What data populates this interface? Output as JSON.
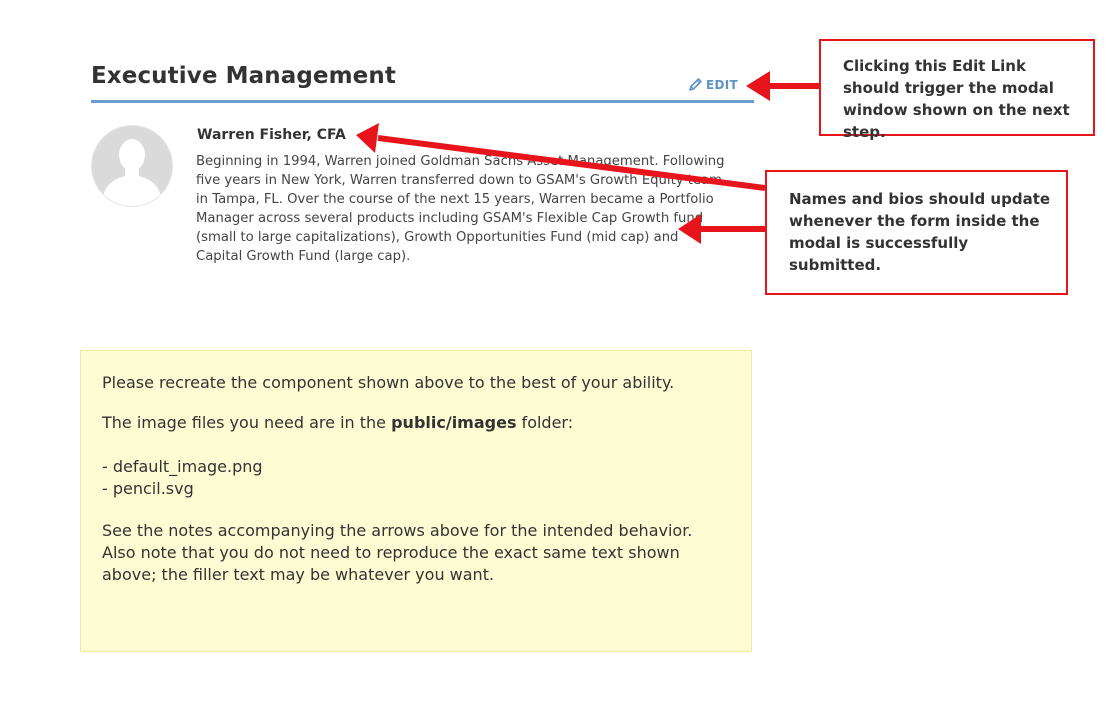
{
  "section": {
    "title": "Executive Management",
    "edit_label": "EDIT",
    "accent_color": "#6a9ccd",
    "link_color": "#5f93c7"
  },
  "profile": {
    "name": "Warren Fisher, CFA",
    "bio": "Beginning in 1994, Warren joined Goldman Sachs Asset Management. Following five years in New York, Warren transferred down to GSAM's Growth Equity team in Tampa, FL. Over the course of the next 15 years, Warren became a Portfolio Manager across several products including GSAM's Flexible Cap Growth fund (small to large capitalizations), Growth Opportunities Fund (mid cap) and Capital Growth Fund (large cap).",
    "avatar_icon": "default-user-icon"
  },
  "callouts": {
    "edit_note": "Clicking this Edit Link should trigger the modal window shown on the next step.",
    "update_note": "Names and bios should update whenever the form inside the modal is successfully submitted.",
    "border_color": "#e8141c"
  },
  "instructions": {
    "intro": "Please recreate the component shown above to the best of your ability.",
    "files_prefix": "The image files you need are in the ",
    "files_folder": "public/images",
    "files_suffix": " folder:",
    "files": [
      "- default_image.png",
      "- pencil.svg"
    ],
    "line_1": "See the notes accompanying the arrows above for the intended behavior.",
    "line_2": "Also note that you do not need to reproduce the exact same text shown",
    "line_3": "above; the filler text may be whatever you want.",
    "background": "#fefcd2"
  }
}
